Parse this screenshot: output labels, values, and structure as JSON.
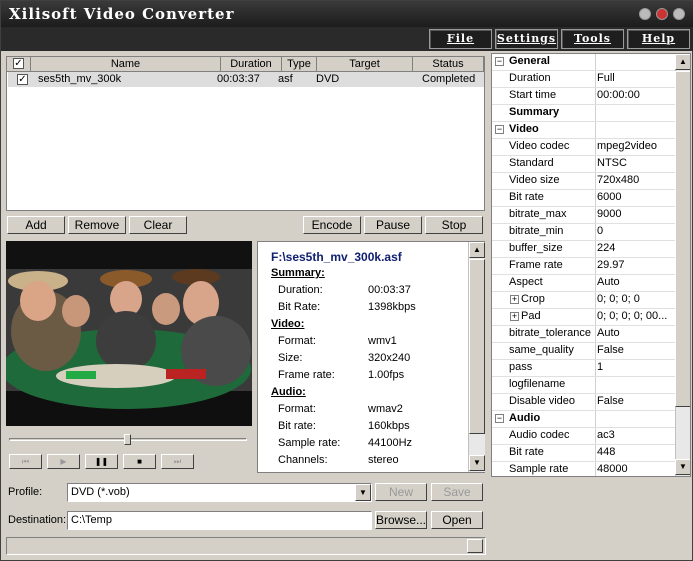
{
  "app": {
    "title": "Xilisoft Video Converter"
  },
  "menu": {
    "file": "File",
    "settings": "Settings",
    "tools": "Tools",
    "help": "Help"
  },
  "files": {
    "columns": {
      "name": "Name",
      "duration": "Duration",
      "type": "Type",
      "target": "Target",
      "status": "Status"
    },
    "rows": [
      {
        "name": "ses5th_mv_300k",
        "duration": "00:03:37",
        "type": "asf",
        "target": "DVD",
        "status": "Completed"
      }
    ]
  },
  "actions": {
    "add": "Add",
    "remove": "Remove",
    "clear": "Clear",
    "encode": "Encode",
    "pause": "Pause",
    "stop": "Stop"
  },
  "info": {
    "path": "F:\\ses5th_mv_300k.asf",
    "summary_h": "Summary:",
    "duration_l": "Duration:",
    "duration_v": "00:03:37",
    "bitrate_l": "Bit Rate:",
    "bitrate_v": "1398kbps",
    "video_h": "Video:",
    "vformat_l": "Format:",
    "vformat_v": "wmv1",
    "size_l": "Size:",
    "size_v": "320x240",
    "fps_l": "Frame rate:",
    "fps_v": "1.00fps",
    "audio_h": "Audio:",
    "aformat_l": "Format:",
    "aformat_v": "wmav2",
    "abitrate_l": "Bit rate:",
    "abitrate_v": "160kbps",
    "srate_l": "Sample rate:",
    "srate_v": "44100Hz",
    "channels_l": "Channels:",
    "channels_v": "stereo"
  },
  "props": [
    {
      "name": "General",
      "value": "",
      "kind": "section",
      "expander": "−"
    },
    {
      "name": "Duration",
      "value": "Full"
    },
    {
      "name": "Start time",
      "value": "00:00:00"
    },
    {
      "name": "Summary",
      "value": "",
      "kind": "bold"
    },
    {
      "name": "Video",
      "value": "",
      "kind": "section",
      "expander": "−"
    },
    {
      "name": "Video codec",
      "value": "mpeg2video"
    },
    {
      "name": "Standard",
      "value": "NTSC"
    },
    {
      "name": "Video size",
      "value": "720x480"
    },
    {
      "name": "Bit rate",
      "value": "6000"
    },
    {
      "name": "bitrate_max",
      "value": "9000"
    },
    {
      "name": "bitrate_min",
      "value": "0"
    },
    {
      "name": "buffer_size",
      "value": "224"
    },
    {
      "name": "Frame rate",
      "value": "29.97"
    },
    {
      "name": "Aspect",
      "value": "Auto"
    },
    {
      "name": "Crop",
      "value": "0; 0; 0; 0",
      "kind": "sub",
      "expander": "+"
    },
    {
      "name": "Pad",
      "value": "0; 0; 0; 0; 00...",
      "kind": "sub",
      "expander": "+"
    },
    {
      "name": "bitrate_tolerance",
      "value": "Auto"
    },
    {
      "name": "same_quality",
      "value": "False"
    },
    {
      "name": "pass",
      "value": "1"
    },
    {
      "name": "logfilename",
      "value": ""
    },
    {
      "name": "Disable video",
      "value": "False"
    },
    {
      "name": "Audio",
      "value": "",
      "kind": "section",
      "expander": "−"
    },
    {
      "name": "Audio codec",
      "value": "ac3"
    },
    {
      "name": "Bit rate",
      "value": "448"
    },
    {
      "name": "Sample rate",
      "value": "48000"
    }
  ],
  "profile": {
    "label": "Profile:",
    "value": "DVD  (*.vob)",
    "new": "New",
    "save": "Save"
  },
  "destination": {
    "label": "Destination:",
    "value": "C:\\Temp",
    "browse": "Browse...",
    "open": "Open"
  },
  "player": {
    "seek_fraction": 0.5,
    "prev": "⏮",
    "play": "▶",
    "pause": "❚❚",
    "stop": "■",
    "next": "⏭"
  }
}
